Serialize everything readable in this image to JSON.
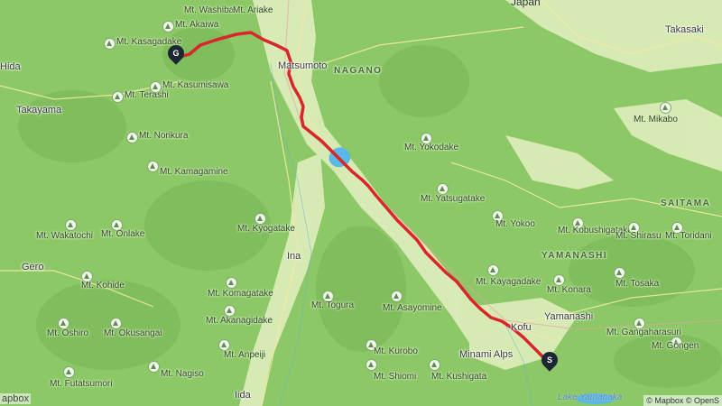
{
  "colors": {
    "route": "#d8262c",
    "forest": "#8cc866",
    "valley": "#dcecb9",
    "water": "#5ab8e6",
    "marker": "#1d2733"
  },
  "labels": {
    "japan": "Japan",
    "takasaki": "Takasaki",
    "hida": "Hida",
    "takayama": "Takayama",
    "matsumoto": "Matsumoto",
    "nagano": "NAGANO",
    "saitama": "SAITAMA",
    "yamanashi_region": "YAMANASHI",
    "ina": "Ina",
    "gero": "Gero",
    "kofu": "Kofu",
    "minami_alps": "Minami Alps",
    "yamanashi_city": "Yamanashi",
    "iida": "Iida",
    "lake": "Lake Yamanaka"
  },
  "peaks": [
    "Mt. Washiba",
    "Mt. Ariake",
    "Mt. Akaiwa",
    "Mt. Kasagadake",
    "Mt. Kasumisawa",
    "Mt. Terashi",
    "Mt. Norikura",
    "Mt. Kamagamine",
    "Mt. Wakatochi",
    "Mt. Onlake",
    "Mt. Kyogatake",
    "Mt. Kohide",
    "Mt. Komagatake",
    "Mt. Akanagidake",
    "Mt. Anpeiji",
    "Mt. Oshiro",
    "Mt. Okusangai",
    "Mt. Nagiso",
    "Mt. Futatsumori",
    "Mt. Togura",
    "Mt. Asayomine",
    "Mt. Kurobo",
    "Mt. Shiomi",
    "Mt. Kushigata",
    "Mt. Yokodake",
    "Mt. Yatsugatake",
    "Mt. Yokoo",
    "Mt. Kobushigatake",
    "Mt. Shirasu",
    "Mt. Toridani",
    "Mt. Kayagadake",
    "Mt. Konara",
    "Mt. Tosaka",
    "Mt. Gangaharasuri",
    "Mt. Gongen",
    "Mt. Mikabo"
  ],
  "markers": {
    "start": "S",
    "goal": "G"
  },
  "attribution": {
    "left": "apbox",
    "right": "© Mapbox © OpenS"
  }
}
